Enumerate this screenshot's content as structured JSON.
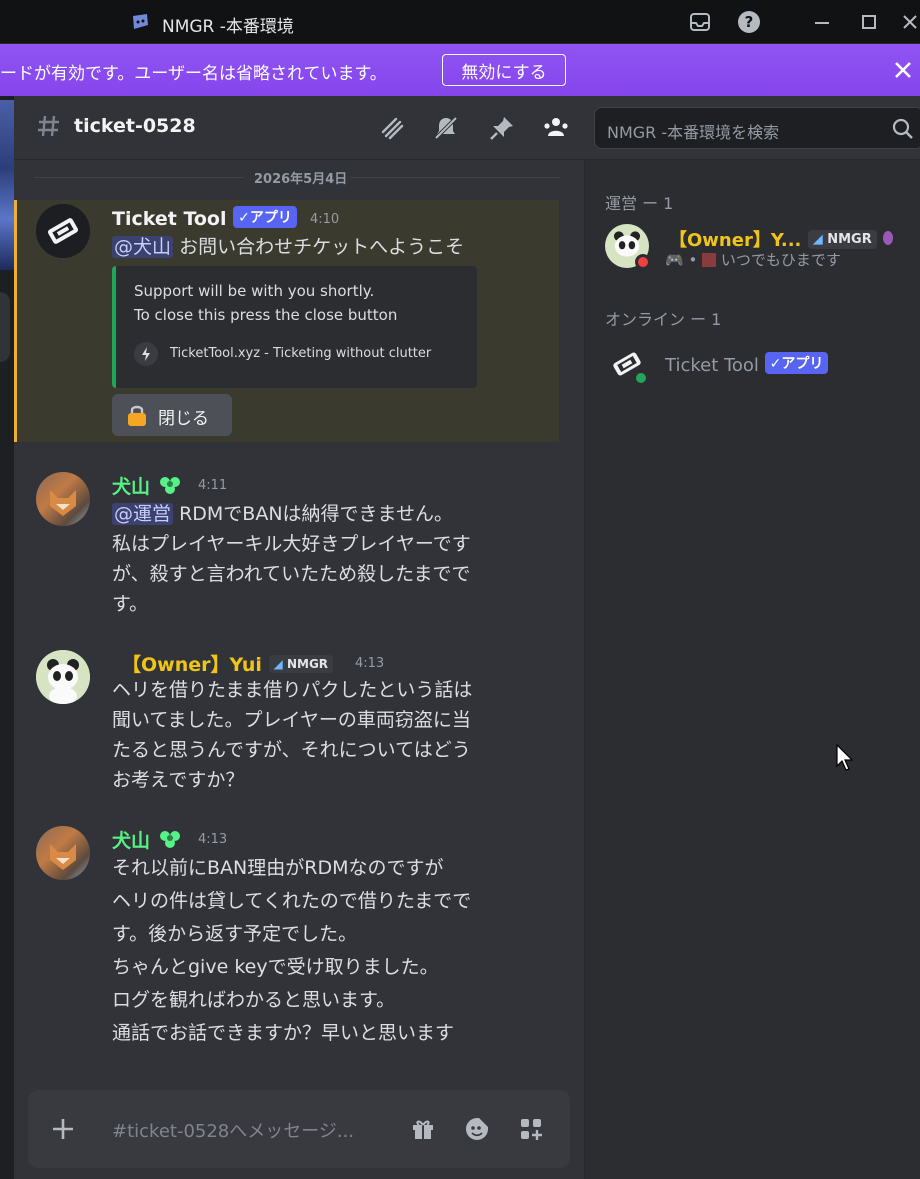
{
  "window": {
    "title": "NMGR -本番環境",
    "icons": [
      "inbox-icon",
      "help-icon",
      "minimize-icon",
      "maximize-icon",
      "close-icon"
    ]
  },
  "notice": {
    "text": "ードが有効です。ユーザー名は省略されています。",
    "button_label": "無効にする"
  },
  "channel": {
    "name": "ticket-0528",
    "header_icons": [
      "threads-icon",
      "mute-icon",
      "pin-icon",
      "members-icon"
    ]
  },
  "search": {
    "placeholder": "NMGR -本番環境を検索"
  },
  "chat": {
    "date": "2026年5月4日",
    "messages": [
      {
        "author": "Ticket Tool",
        "badge": "✓アプリ",
        "time": "4:10",
        "mention": "@犬山",
        "text": "お問い合わせチケットへようこそ",
        "embed": {
          "line1": "Support will be with you shortly.",
          "line2": "To close this press the close button",
          "footer": "TicketTool.xyz - Ticketing without clutter"
        },
        "button": "閉じる"
      },
      {
        "author": "犬山",
        "time": "4:11",
        "mention": "@運営",
        "lines": [
          "RDMでBANは納得できません。",
          "私はプレイヤーキル大好きプレイヤーです",
          "が、殺すと言われていたため殺したまでで",
          "す。"
        ]
      },
      {
        "author": "【Owner】Yui",
        "tag": "NMGR",
        "time": "4:13",
        "lines": [
          "ヘリを借りたまま借りパクしたという話は",
          "聞いてました。プレイヤーの車両窃盗に当",
          "たると思うんですが、それについてはどう",
          "お考えですか？"
        ]
      },
      {
        "author": "犬山",
        "time": "4:13",
        "lines": [
          "それ以前にBAN理由がRDMなのですが",
          "ヘリの件は貸してくれたので借りたまでで",
          "す。後から返す予定でした。",
          "ちゃんとgive keyで受け取りました。",
          "ログを観ればわかると思います。",
          "通話でお話できますか？早いと思います"
        ]
      }
    ]
  },
  "composer": {
    "placeholder": "#ticket-0528へメッセージ..."
  },
  "members": {
    "groups": [
      {
        "label": "運営 ー 1",
        "members": [
          {
            "name": "【Owner】Y...",
            "tag": "NMGR",
            "status": "いつでもひまです",
            "presence": "dnd"
          }
        ]
      },
      {
        "label": "オンライン ー 1",
        "members": [
          {
            "name": "Ticket Tool",
            "badge": "✓アプリ",
            "presence": "online"
          }
        ]
      }
    ]
  },
  "colors": {
    "accent": "#5865f2",
    "notice": "#8c4bf0",
    "online": "#23a559",
    "dnd": "#f23f43",
    "owner_name": "#f0c419",
    "inuyama_name": "#57f287",
    "highlight_border": "#f0b132"
  }
}
